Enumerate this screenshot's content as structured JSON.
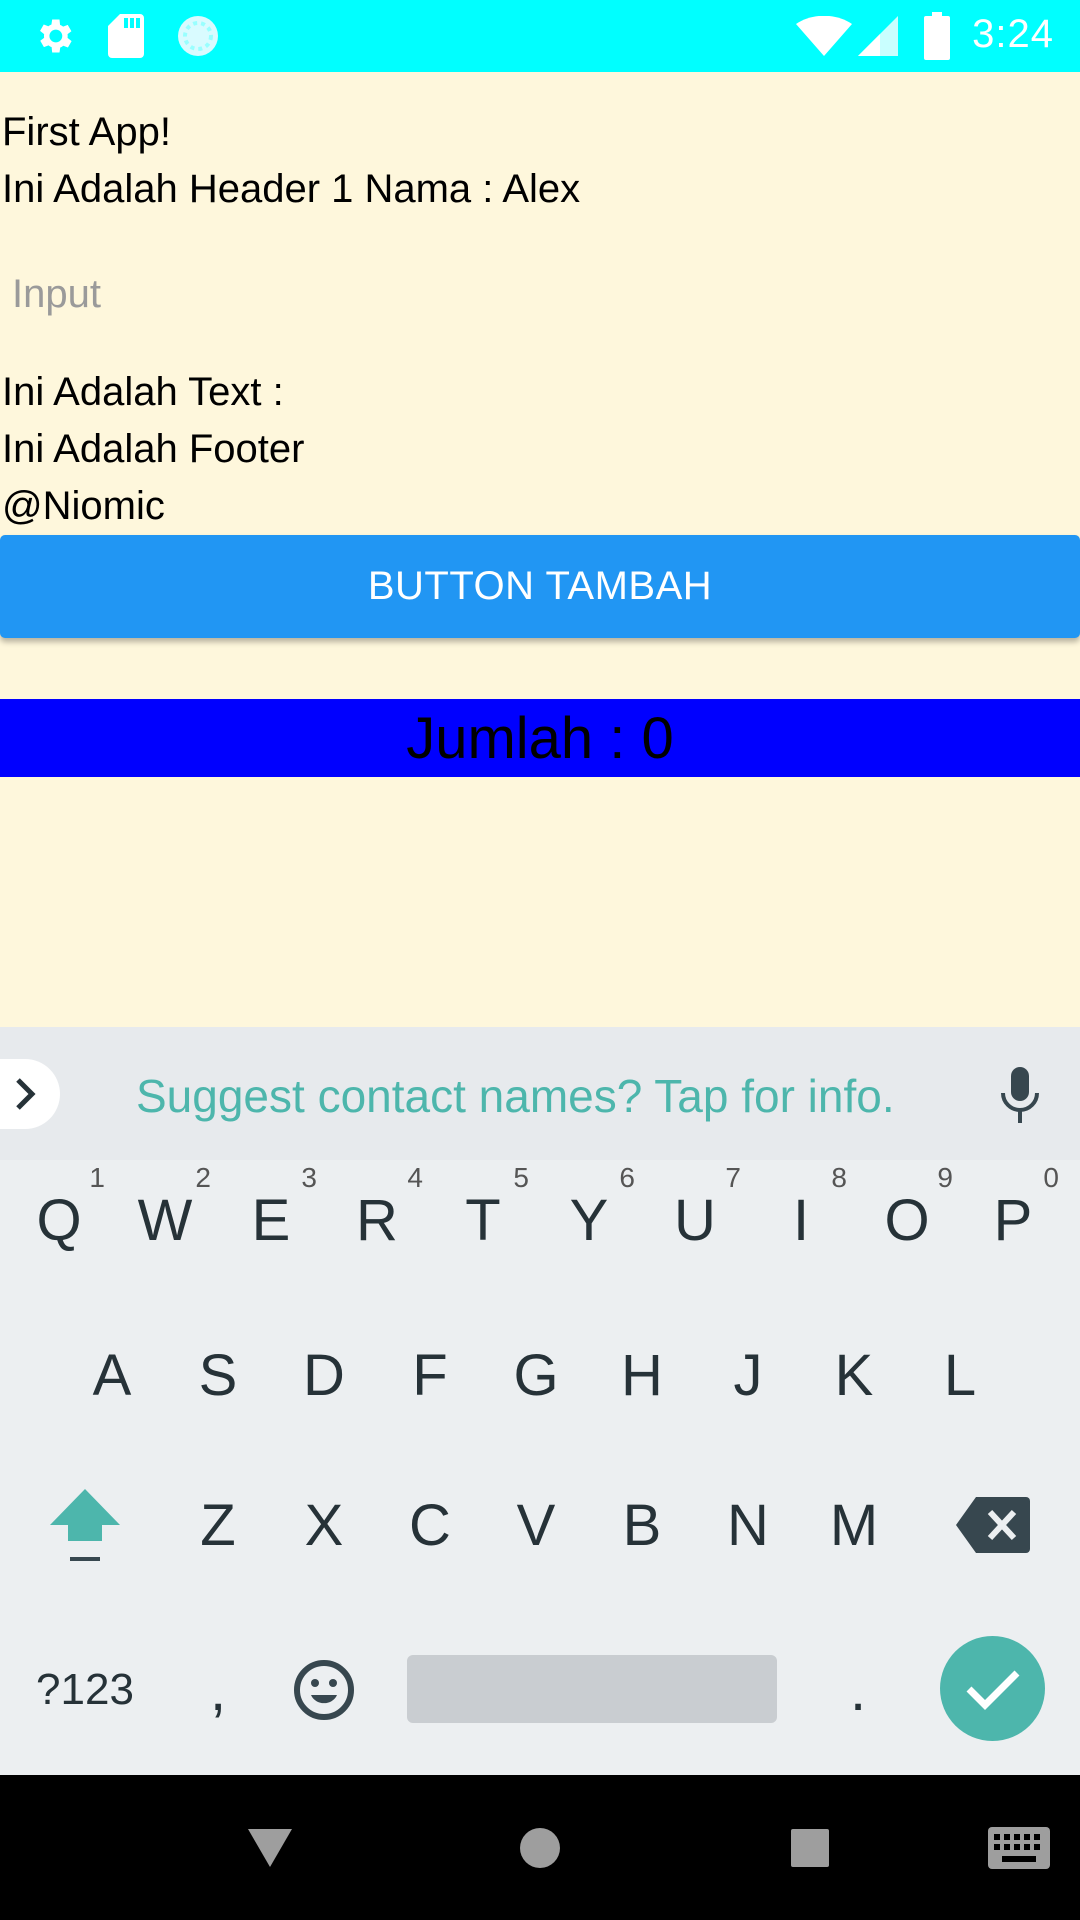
{
  "status_bar": {
    "icons": [
      "settings-icon",
      "sd-card-icon",
      "sync-circle-icon",
      "wifi-icon",
      "cell-signal-icon",
      "battery-icon"
    ],
    "time": "3:24",
    "background": "#00ffff"
  },
  "app": {
    "background": "#fef7dc",
    "title": "First App!",
    "header": "Ini Adalah Header 1 Nama : Alex",
    "input": {
      "value": "",
      "placeholder": "Input"
    },
    "text_line": "Ini Adalah Text :",
    "footer": "Ini Adalah Footer",
    "credit": "@Niomic",
    "button": {
      "label": "BUTTON TAMBAH",
      "color": "#2196f3"
    },
    "counter": {
      "text": "Jumlah : 0",
      "background": "#0000ff"
    }
  },
  "keyboard": {
    "suggestion": "Suggest contact names? Tap for info.",
    "accent": "#4db6ac",
    "row1": [
      {
        "key": "Q",
        "hint": "1"
      },
      {
        "key": "W",
        "hint": "2"
      },
      {
        "key": "E",
        "hint": "3"
      },
      {
        "key": "R",
        "hint": "4"
      },
      {
        "key": "T",
        "hint": "5"
      },
      {
        "key": "Y",
        "hint": "6"
      },
      {
        "key": "U",
        "hint": "7"
      },
      {
        "key": "I",
        "hint": "8"
      },
      {
        "key": "O",
        "hint": "9"
      },
      {
        "key": "P",
        "hint": "0"
      }
    ],
    "row2": [
      "A",
      "S",
      "D",
      "F",
      "G",
      "H",
      "J",
      "K",
      "L"
    ],
    "row3": [
      "Z",
      "X",
      "C",
      "V",
      "B",
      "N",
      "M"
    ],
    "symbols_label": "?123",
    "comma_label": ",",
    "period_label": "."
  },
  "nav_bar": {
    "icons": [
      "back-icon",
      "home-icon",
      "recents-icon",
      "keyboard-switch-icon"
    ]
  }
}
